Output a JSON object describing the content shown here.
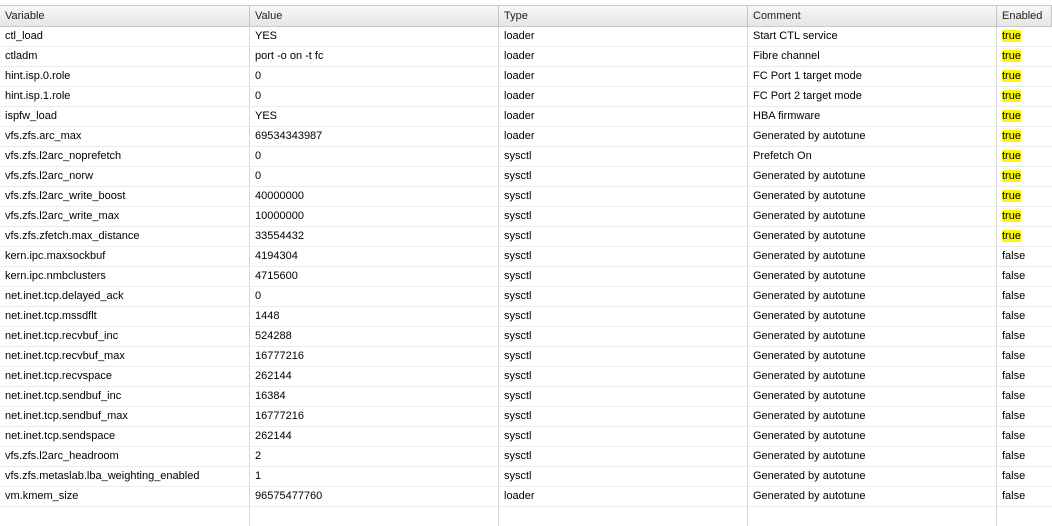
{
  "table": {
    "columns": [
      "Variable",
      "Value",
      "Type",
      "Comment",
      "Enabled"
    ],
    "rows": [
      [
        "ctl_load",
        "YES",
        "loader",
        "Start CTL service",
        "true"
      ],
      [
        "ctladm",
        "port -o on -t fc",
        "loader",
        "Fibre channel",
        "true"
      ],
      [
        "hint.isp.0.role",
        "0",
        "loader",
        "FC Port 1 target mode",
        "true"
      ],
      [
        "hint.isp.1.role",
        "0",
        "loader",
        "FC Port 2 target mode",
        "true"
      ],
      [
        "ispfw_load",
        "YES",
        "loader",
        "HBA firmware",
        "true"
      ],
      [
        "vfs.zfs.arc_max",
        "69534343987",
        "loader",
        "Generated by autotune",
        "true"
      ],
      [
        "vfs.zfs.l2arc_noprefetch",
        "0",
        "sysctl",
        "Prefetch On",
        "true"
      ],
      [
        "vfs.zfs.l2arc_norw",
        "0",
        "sysctl",
        "Generated by autotune",
        "true"
      ],
      [
        "vfs.zfs.l2arc_write_boost",
        "40000000",
        "sysctl",
        "Generated by autotune",
        "true"
      ],
      [
        "vfs.zfs.l2arc_write_max",
        "10000000",
        "sysctl",
        "Generated by autotune",
        "true"
      ],
      [
        "vfs.zfs.zfetch.max_distance",
        "33554432",
        "sysctl",
        "Generated by autotune",
        "true"
      ],
      [
        "kern.ipc.maxsockbuf",
        "4194304",
        "sysctl",
        "Generated by autotune",
        "false"
      ],
      [
        "kern.ipc.nmbclusters",
        "4715600",
        "sysctl",
        "Generated by autotune",
        "false"
      ],
      [
        "net.inet.tcp.delayed_ack",
        "0",
        "sysctl",
        "Generated by autotune",
        "false"
      ],
      [
        "net.inet.tcp.mssdflt",
        "1448",
        "sysctl",
        "Generated by autotune",
        "false"
      ],
      [
        "net.inet.tcp.recvbuf_inc",
        "524288",
        "sysctl",
        "Generated by autotune",
        "false"
      ],
      [
        "net.inet.tcp.recvbuf_max",
        "16777216",
        "sysctl",
        "Generated by autotune",
        "false"
      ],
      [
        "net.inet.tcp.recvspace",
        "262144",
        "sysctl",
        "Generated by autotune",
        "false"
      ],
      [
        "net.inet.tcp.sendbuf_inc",
        "16384",
        "sysctl",
        "Generated by autotune",
        "false"
      ],
      [
        "net.inet.tcp.sendbuf_max",
        "16777216",
        "sysctl",
        "Generated by autotune",
        "false"
      ],
      [
        "net.inet.tcp.sendspace",
        "262144",
        "sysctl",
        "Generated by autotune",
        "false"
      ],
      [
        "vfs.zfs.l2arc_headroom",
        "2",
        "sysctl",
        "Generated by autotune",
        "false"
      ],
      [
        "vfs.zfs.metaslab.lba_weighting_enabled",
        "1",
        "sysctl",
        "Generated by autotune",
        "false"
      ],
      [
        "vm.kmem_size",
        "96575477760",
        "loader",
        "Generated by autotune",
        "false"
      ]
    ]
  },
  "colors": {
    "enabled_highlight": "#fbf60a",
    "header_bg": "#ececec",
    "grid_line": "#d8d8d8"
  }
}
